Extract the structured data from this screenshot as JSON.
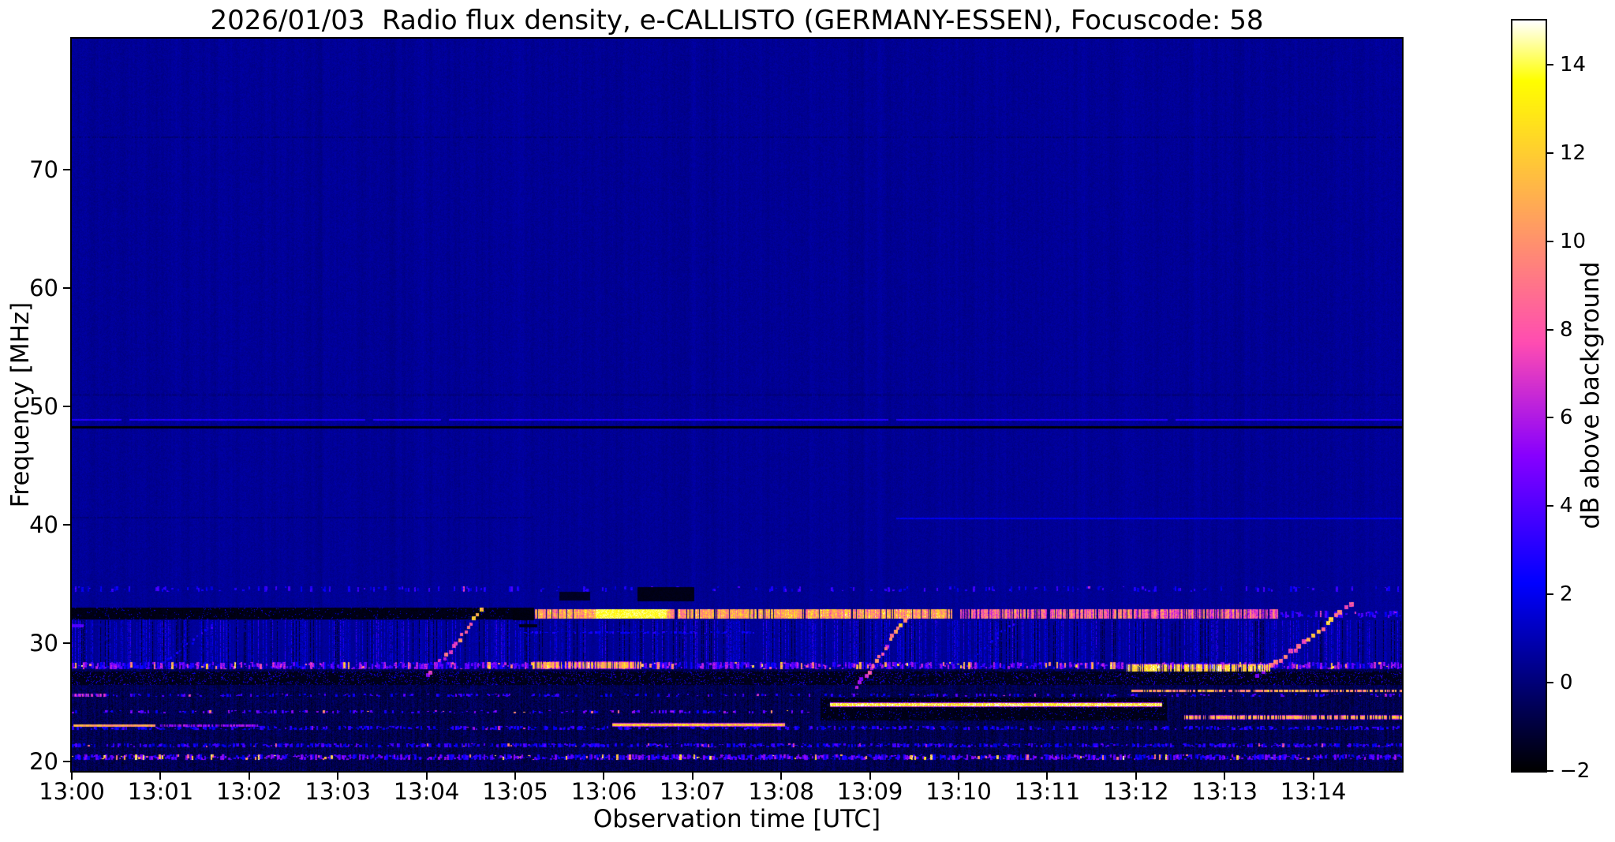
{
  "figure": {
    "title": "2026/01/03  Radio flux density, e-CALLISTO (GERMANY-ESSEN), Focuscode: 58",
    "date": "2026/01/03",
    "instrument": "e-CALLISTO",
    "station": "GERMANY-ESSEN",
    "focuscode": "58"
  },
  "chart_data": {
    "type": "heatmap",
    "subtype": "radio-spectrogram",
    "title": "2026/01/03  Radio flux density, e-CALLISTO (GERMANY-ESSEN), Focuscode: 58",
    "xlabel": "Observation time [UTC]",
    "ylabel": "Frequency [MHz]",
    "x_ticks": [
      "13:00",
      "13:01",
      "13:02",
      "13:03",
      "13:04",
      "13:05",
      "13:06",
      "13:07",
      "13:08",
      "13:09",
      "13:10",
      "13:11",
      "13:12",
      "13:13",
      "13:14"
    ],
    "x_minutes_span": 15,
    "x_start_utc": "13:00",
    "x_end_utc": "13:15",
    "y_ticks": [
      20,
      30,
      40,
      50,
      60,
      70
    ],
    "ylim": [
      19.2,
      81.07
    ],
    "grid": false,
    "legend": "colorbar-right",
    "colorbar": {
      "label": "dB above background",
      "min": -2,
      "max": 15,
      "ticks": [
        14,
        12,
        10,
        8,
        6,
        4,
        2,
        0,
        -2
      ],
      "tick_labels": [
        "14",
        "12",
        "10",
        "8",
        "6",
        "4",
        "2",
        "0",
        "−2"
      ],
      "colormap": "gnuplot2"
    },
    "background_db": [
      0.2,
      0.9
    ],
    "background_color_hint": "#00008c",
    "accent_colors": {
      "bright_band": "#ffae3c",
      "hot": "#fff6c8",
      "magenta": "#e040c8",
      "blue": "#2222ee"
    },
    "features": [
      {
        "kind": "dark_noise",
        "f": [
          19.2,
          27.75
        ],
        "t": [
          0,
          15
        ],
        "db": [
          -1.7,
          0.4
        ]
      },
      {
        "kind": "vstreaks",
        "f": [
          27.8,
          31.9
        ],
        "t": [
          0,
          15
        ],
        "density": 0.5,
        "db": [
          1.0,
          3.2
        ],
        "dark_density": 0.15,
        "dark_db": -1.3
      },
      {
        "kind": "dark_line",
        "f": 72.7,
        "t": [
          0,
          15
        ],
        "db": -0.1,
        "h": 2,
        "gap": 0.45
      },
      {
        "kind": "dark_line",
        "f": 51.0,
        "t": [
          0,
          15
        ],
        "db": 0.15,
        "h": 3,
        "gap": 0.25
      },
      {
        "kind": "dark_line",
        "f": 40.6,
        "t": [
          0,
          5.2
        ],
        "db": 0.0,
        "h": 2,
        "gap": 0.3
      },
      {
        "kind": "bright_line",
        "f": 40.5,
        "t": [
          9.3,
          15
        ],
        "db": 1.7,
        "h": 2,
        "notches": []
      },
      {
        "kind": "bright_line",
        "f": 48.85,
        "t": [
          0,
          15
        ],
        "db": 2.7,
        "h": 2,
        "notches": [
          0.6,
          3.35,
          4.2,
          9.25,
          12.4
        ]
      },
      {
        "kind": "dark_line",
        "f": 48.25,
        "t": [
          0,
          15
        ],
        "db": -1.9,
        "h": 3,
        "gap": 0
      },
      {
        "kind": "speckle_row",
        "f": 34.6,
        "h": 7,
        "t": [
          0,
          15
        ],
        "density": 0.22,
        "db": [
          1.5,
          3.8
        ],
        "hot": 0.02,
        "hot_db": [
          5,
          8
        ]
      },
      {
        "kind": "blob",
        "t": [
          6.38,
          7.02
        ],
        "f": [
          33.5,
          34.7
        ],
        "db": -1.6
      },
      {
        "kind": "blob",
        "t": [
          5.5,
          5.85
        ],
        "f": [
          33.6,
          34.3
        ],
        "db": -1.4
      },
      {
        "kind": "band",
        "f": [
          31.95,
          32.95
        ],
        "t": [
          0,
          5.05
        ],
        "db": -1.7,
        "speckle": 0.04,
        "speckle_db": [
          1.5,
          3
        ]
      },
      {
        "kind": "band_bright",
        "f": [
          32.05,
          32.85
        ],
        "t": [
          5.05,
          9.93
        ],
        "db": [
          8.5,
          12.5
        ],
        "white": [
          5.9,
          6.7
        ],
        "gap": 0.1
      },
      {
        "kind": "band_bright",
        "f": [
          32.05,
          32.85
        ],
        "t": [
          10.02,
          13.62
        ],
        "db": [
          6,
          10.5
        ],
        "white": null,
        "gap": 0.22
      },
      {
        "kind": "blob",
        "t": [
          4.98,
          5.22
        ],
        "f": [
          31.9,
          33.0
        ],
        "db": -1.7
      },
      {
        "kind": "speckle_row",
        "f": 32.45,
        "h": 9,
        "t": [
          13.62,
          15
        ],
        "density": 0.5,
        "db": [
          1.8,
          4.5
        ],
        "hot": 0.04,
        "hot_db": [
          6,
          8
        ]
      },
      {
        "kind": "dash_line",
        "f": 31.45,
        "t": [
          0,
          5.05
        ],
        "db": 3.8,
        "h": 4,
        "on": 0.13,
        "off": 0.1
      },
      {
        "kind": "dash_line",
        "f": 31.45,
        "t": [
          5.05,
          15
        ],
        "db": -1.6,
        "h": 4,
        "on": 0.2,
        "off": 0.15
      },
      {
        "kind": "speckle_row",
        "f": 30.9,
        "h": 3,
        "t": [
          5.1,
          7.7
        ],
        "density": 0.5,
        "db": [
          1.4,
          3.0
        ],
        "hot": 0,
        "hot_db": [
          0,
          0
        ]
      },
      {
        "kind": "speckle_row",
        "f": 28.1,
        "h": 9,
        "t": [
          0,
          15
        ],
        "density": 0.8,
        "db": [
          1.8,
          6.5
        ],
        "hot": 0.15,
        "hot_db": [
          8,
          13
        ]
      },
      {
        "kind": "bright_segments",
        "f": 28.1,
        "h": 8,
        "segs": [
          [
            5.2,
            6.45
          ]
        ],
        "db": [
          8.5,
          12.5
        ],
        "dotted": true
      },
      {
        "kind": "bright_segments",
        "f": 27.9,
        "h": 9,
        "segs": [
          [
            11.9,
            13.52
          ]
        ],
        "db": [
          10.5,
          14.2
        ],
        "dotted": true
      },
      {
        "kind": "band",
        "f": [
          26.45,
          27.55
        ],
        "t": [
          0,
          15
        ],
        "db": -1.6,
        "speckle": 0.1,
        "speckle_db": [
          1.5,
          3.5
        ]
      },
      {
        "kind": "bright_segments",
        "f": 26.0,
        "h": 3,
        "segs": [
          [
            11.95,
            15
          ]
        ],
        "db": [
          8.5,
          12
        ],
        "dotted": true
      },
      {
        "kind": "speckle_row",
        "f": 25.6,
        "h": 4,
        "t": [
          0,
          15
        ],
        "density": 0.28,
        "db": [
          1.5,
          4.5
        ],
        "hot": 0.03,
        "hot_db": [
          5.5,
          7.5
        ]
      },
      {
        "kind": "bright_segments",
        "f": 25.6,
        "h": 4,
        "segs": [
          [
            0.0,
            0.4
          ]
        ],
        "db": [
          5,
          8
        ],
        "dotted": true
      },
      {
        "kind": "band",
        "f": [
          23.45,
          25.4
        ],
        "t": [
          8.45,
          12.35
        ],
        "db": -1.65,
        "speckle": 0.05,
        "speckle_db": [
          1.5,
          3
        ]
      },
      {
        "kind": "bright_segments",
        "f": 24.75,
        "h": 4,
        "segs": [
          [
            8.55,
            12.3
          ]
        ],
        "db": [
          12.5,
          14.6
        ],
        "dotted": false
      },
      {
        "kind": "speckle_row",
        "f": 24.2,
        "h": 4,
        "t": [
          0,
          8.4
        ],
        "density": 0.3,
        "db": [
          1.8,
          5.5
        ],
        "hot": 0.06,
        "hot_db": [
          7.5,
          10.5
        ]
      },
      {
        "kind": "bright_segments",
        "f": 23.7,
        "h": 4,
        "segs": [
          [
            12.55,
            15
          ]
        ],
        "db": [
          9,
          12.5
        ],
        "dotted": true
      },
      {
        "kind": "bright_segments",
        "f": 23.05,
        "h": 3,
        "segs": [
          [
            0.02,
            0.95
          ]
        ],
        "db": [
          9.5,
          11.5
        ],
        "dotted": false
      },
      {
        "kind": "bright_segments",
        "f": 23.05,
        "h": 3,
        "segs": [
          [
            1.0,
            2.1
          ]
        ],
        "db": [
          4.5,
          6.5
        ],
        "dotted": true
      },
      {
        "kind": "bright_segments",
        "f": 23.1,
        "h": 3,
        "segs": [
          [
            6.1,
            8.05
          ]
        ],
        "db": [
          10.5,
          12.8
        ],
        "dotted": false
      },
      {
        "kind": "speckle_row",
        "f": 22.85,
        "h": 5,
        "t": [
          0,
          15
        ],
        "density": 0.5,
        "db": [
          1.4,
          3.8
        ],
        "hot": 0.02,
        "hot_db": [
          5,
          7
        ]
      },
      {
        "kind": "speckle_row",
        "f": 21.4,
        "h": 5,
        "t": [
          0,
          15
        ],
        "density": 0.65,
        "db": [
          1.4,
          4.2
        ],
        "hot": 0.04,
        "hot_db": [
          6,
          9.5
        ]
      },
      {
        "kind": "speckle_row",
        "f": 20.4,
        "h": 7,
        "t": [
          0,
          15
        ],
        "density": 0.85,
        "db": [
          1.8,
          5.5
        ],
        "hot": 0.1,
        "hot_db": [
          9,
          13.5
        ]
      },
      {
        "kind": "drift",
        "from": [
          0.95,
          27.8
        ],
        "to": [
          1.6,
          31.6
        ],
        "db": [
          2,
          3.4
        ],
        "w": 2,
        "step": 5
      },
      {
        "kind": "drift",
        "from": [
          4.02,
          27.3
        ],
        "to": [
          4.62,
          32.7
        ],
        "db": [
          6.5,
          11.5
        ],
        "w": 4,
        "step": 6
      },
      {
        "kind": "drift",
        "from": [
          8.86,
          26.3
        ],
        "to": [
          9.42,
          32.3
        ],
        "db": [
          6,
          12
        ],
        "w": 4,
        "step": 6
      },
      {
        "kind": "drift",
        "from": [
          10.15,
          28.6
        ],
        "to": [
          10.6,
          31.7
        ],
        "db": [
          2,
          3.2
        ],
        "w": 2,
        "step": 5
      },
      {
        "kind": "drift",
        "from": [
          13.38,
          27.3
        ],
        "to": [
          14.42,
          33.2
        ],
        "db": [
          7,
          13
        ],
        "w": 5,
        "step": 7
      }
    ]
  }
}
